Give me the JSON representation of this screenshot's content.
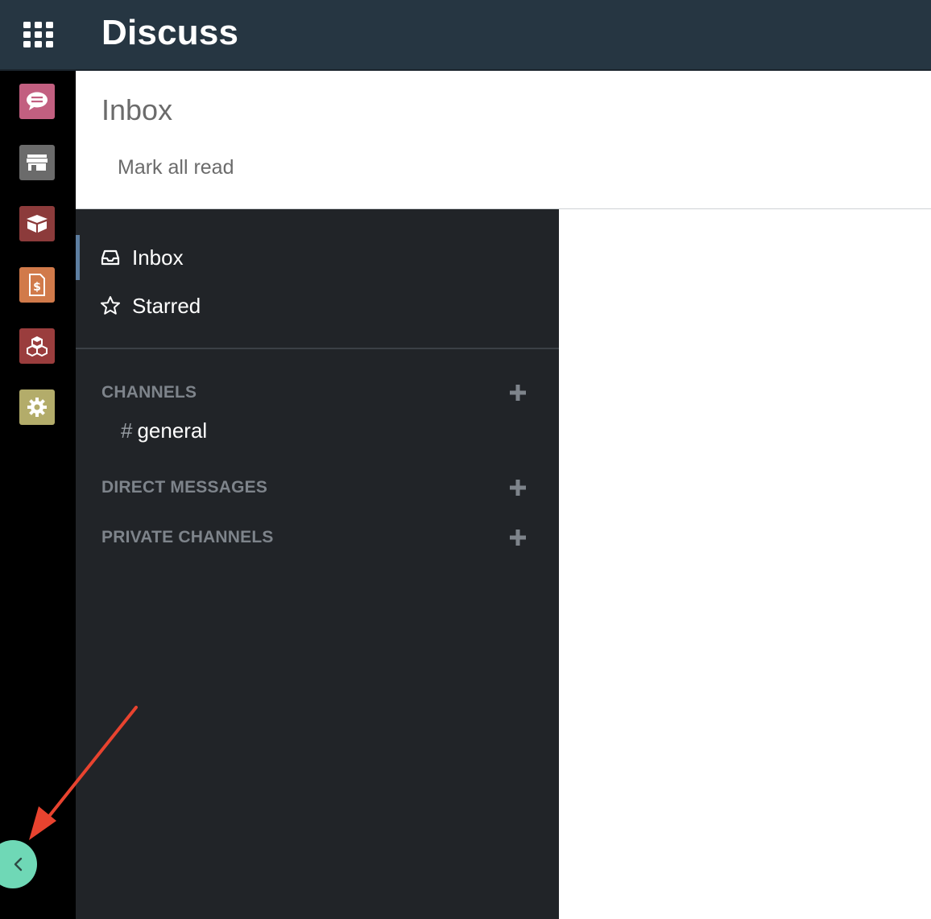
{
  "topbar": {
    "title": "Discuss",
    "apps_icon": "grid-icon"
  },
  "rail": {
    "apps": [
      {
        "name": "discuss",
        "icon": "chat-bubble-icon",
        "color": "#c25f80"
      },
      {
        "name": "store",
        "icon": "store-icon",
        "color": "#7a7a7a"
      },
      {
        "name": "inventory",
        "icon": "box-icon",
        "color": "#8c3b3b"
      },
      {
        "name": "invoicing",
        "icon": "invoice-dollar-icon",
        "color": "#d17a4a"
      },
      {
        "name": "modules",
        "icon": "cubes-icon",
        "color": "#9a3d3d"
      },
      {
        "name": "settings",
        "icon": "gear-icon",
        "color": "#b3ac6a"
      }
    ],
    "collapse_icon": "chevron-left-icon",
    "collapse_color": "#6fd8b6"
  },
  "control_panel": {
    "title": "Inbox",
    "mark_all_read": "Mark all read"
  },
  "sidebar": {
    "mailboxes": [
      {
        "label": "Inbox",
        "icon": "inbox-icon",
        "active": true
      },
      {
        "label": "Starred",
        "icon": "star-icon",
        "active": false
      }
    ],
    "sections": [
      {
        "label": "CHANNELS",
        "add_icon": "plus-icon"
      },
      {
        "label": "DIRECT MESSAGES",
        "add_icon": "plus-icon"
      },
      {
        "label": "PRIVATE CHANNELS",
        "add_icon": "plus-icon"
      }
    ],
    "channels": [
      {
        "hash": "#",
        "name": "general"
      }
    ]
  },
  "colors": {
    "topbar_bg": "#263642",
    "sidebar_bg": "#212428",
    "active_indicator": "#5d7ea1",
    "annotation_arrow": "#e8432f"
  }
}
